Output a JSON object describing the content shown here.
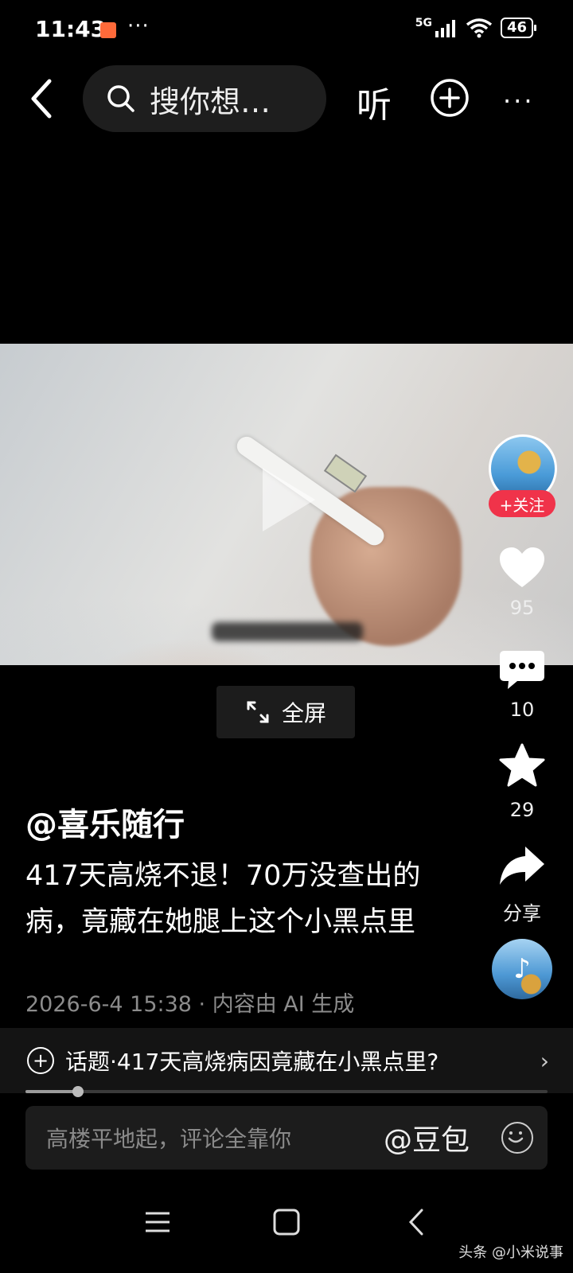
{
  "status_bar": {
    "time": "11:43",
    "dots": "···",
    "network": "5G",
    "battery": "46"
  },
  "top_bar": {
    "search_placeholder": "搜你想…",
    "listen_label": "听",
    "more": "···"
  },
  "video": {
    "fullscreen_label": "全屏"
  },
  "rail": {
    "follow_label": "+关注",
    "like_count": "95",
    "comment_count": "10",
    "favorite_count": "29",
    "share_label": "分享"
  },
  "post": {
    "author": "@喜乐随行",
    "title": "417天高烧不退！70万没查出的病，竟藏在她腿上这个小黑点里",
    "meta": "2026-6-4 15:38 · 内容由 AI 生成"
  },
  "topic": {
    "text": "话题·417天高烧病因竟藏在小黑点里?"
  },
  "progress": {
    "value": 0.1
  },
  "comment_bar": {
    "placeholder": "高楼平地起，评论全靠你",
    "mention": "@豆包"
  },
  "watermark": "头条 @小米说事"
}
